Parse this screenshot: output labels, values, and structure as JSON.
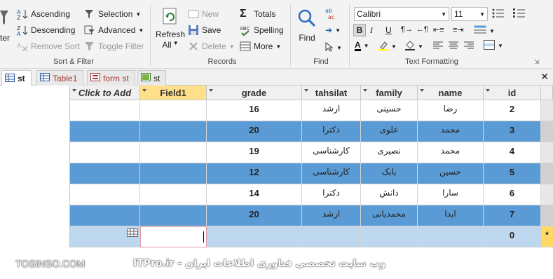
{
  "ribbon": {
    "sort": {
      "ascending": "Ascending",
      "descending": "Descending",
      "remove_sort": "Remove Sort",
      "selection": "Selection",
      "advanced": "Advanced",
      "toggle_filter": "Toggle Filter",
      "filter_partial": "ter",
      "group_label": "Sort & Filter"
    },
    "records": {
      "refresh": "Refresh",
      "refresh_all": "All",
      "new": "New",
      "save": "Save",
      "delete": "Delete",
      "totals": "Totals",
      "spelling": "Spelling",
      "more": "More",
      "group_label": "Records"
    },
    "find": {
      "find": "Find",
      "group_label": "Find"
    },
    "text": {
      "font": "Calibri",
      "size": "11",
      "group_label": "Text Formatting"
    }
  },
  "tabs": [
    {
      "label": "st"
    },
    {
      "label": "Table1"
    },
    {
      "label": "form st"
    },
    {
      "label": "st"
    }
  ],
  "grid": {
    "headers": [
      "Click to Add",
      "Field1",
      "grade",
      "tahsilat",
      "family",
      "name",
      "id"
    ],
    "rows": [
      {
        "grade": "16",
        "tahsilat": "ارشد",
        "family": "حسینی",
        "name": "رضا",
        "id": "2"
      },
      {
        "grade": "20",
        "tahsilat": "دکترا",
        "family": "علوی",
        "name": "محمد",
        "id": "3"
      },
      {
        "grade": "19",
        "tahsilat": "کارشناسی",
        "family": "نصیری",
        "name": "محمد",
        "id": "4"
      },
      {
        "grade": "12",
        "tahsilat": "کارشناسی",
        "family": "بابک",
        "name": "حسین",
        "id": "5"
      },
      {
        "grade": "14",
        "tahsilat": "دکترا",
        "family": "دانش",
        "name": "سارا",
        "id": "6"
      },
      {
        "grade": "20",
        "tahsilat": "ارشد",
        "family": "محمدیانی",
        "name": "ایدا",
        "id": "7"
      }
    ],
    "new_row": {
      "id": "0",
      "marker": "*"
    }
  },
  "watermark": {
    "left": "TOSINSO.COM",
    "right": "ITPro.ir - وب سایت تخصصی فناوری اطلاعات ایران"
  },
  "colors": {
    "selected_row": "#5b9bd5",
    "new_row": "#bdd7ee",
    "field1_header": "#ffe08a"
  }
}
